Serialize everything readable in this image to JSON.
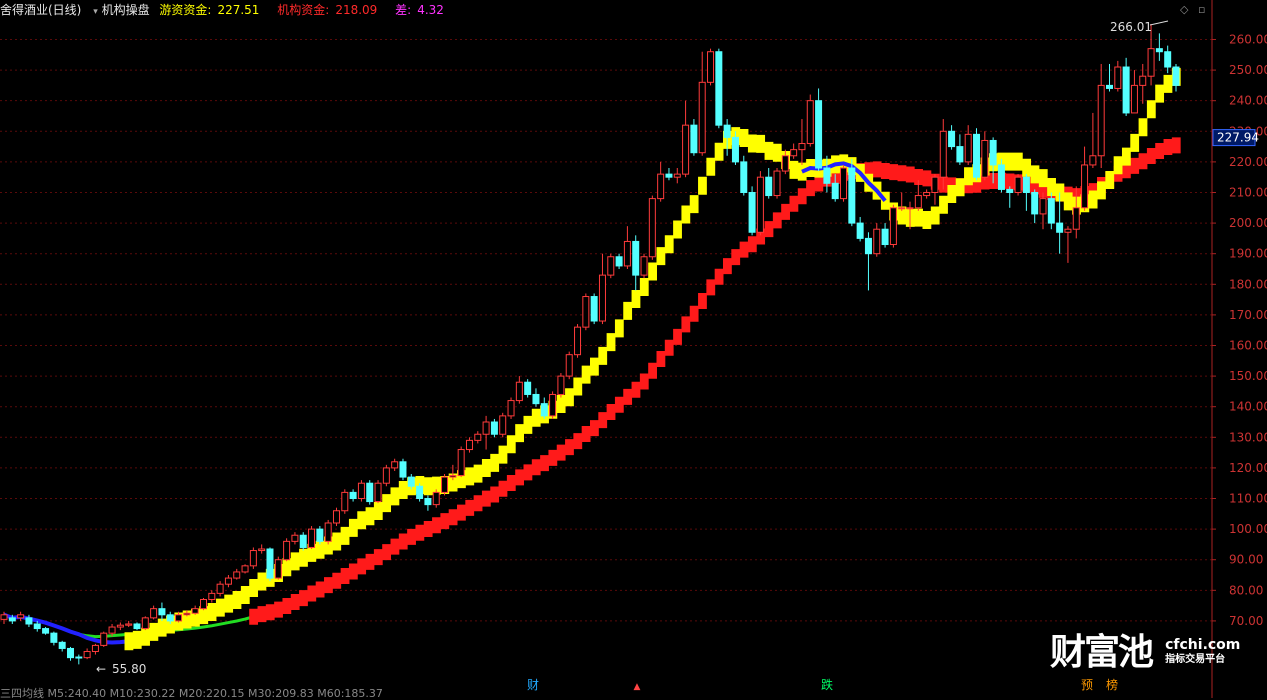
{
  "header": {
    "stock_name": "舍得酒业(日线)",
    "indicator_name": "机构操盘",
    "hot_money_label": "游资资金:",
    "hot_money_value": "227.51",
    "inst_label": "机构资金:",
    "inst_value": "218.09",
    "diff_label": "差:",
    "diff_value": "4.32",
    "colors": {
      "stock": "#e8e8e8",
      "indicator": "#e8e8e8",
      "hot_money": "#ffff00",
      "inst": "#ff2a2a",
      "diff": "#ff33ff"
    }
  },
  "corner_icons": {
    "diamond": "◇",
    "scroll_up": "▫"
  },
  "watermark": {
    "brand": "财富池",
    "url": "cfchi.com",
    "tagline": "指标交易平台"
  },
  "footer": {
    "text": "三四均线 M5:240.40 M10:230.22 M20:220.15 M30:209.83 M60:185.37"
  },
  "markers": [
    {
      "text": "财",
      "color": "#22aaff"
    },
    {
      "text": "▲",
      "color": "#ff4444"
    },
    {
      "text": "跌",
      "color": "#00ff66"
    },
    {
      "text": "预",
      "color": "#ff9900"
    },
    {
      "text": "榜",
      "color": "#ff9900"
    }
  ],
  "chart_data": {
    "type": "candlestick",
    "title": "舍得酒业(日线)",
    "y_axis": {
      "min": 52,
      "max": 268,
      "ticks": [
        70,
        80,
        90,
        100,
        110,
        120,
        130,
        140,
        150,
        160,
        170,
        180,
        190,
        200,
        210,
        220,
        230,
        240,
        250,
        260
      ],
      "side": "right"
    },
    "grid": true,
    "current_price_label": "227.94",
    "annotations": {
      "high": "266.01",
      "low": "55.80"
    },
    "candles": [
      [
        70.5,
        72,
        73,
        69
      ],
      [
        71,
        70,
        72,
        69
      ],
      [
        71,
        72,
        73,
        70
      ],
      [
        71,
        69,
        72,
        68
      ],
      [
        69,
        67.5,
        70,
        66.5
      ],
      [
        67.5,
        66,
        68,
        65.5
      ],
      [
        66,
        63,
        66.5,
        62
      ],
      [
        63,
        61,
        63.5,
        60
      ],
      [
        61,
        58,
        61.5,
        57
      ],
      [
        58.2,
        58,
        59,
        55.8
      ],
      [
        58,
        60,
        61,
        57.5
      ],
      [
        60,
        62,
        62.5,
        59
      ],
      [
        62,
        66,
        66.5,
        61.5
      ],
      [
        66,
        68,
        69,
        65
      ],
      [
        68,
        68.6,
        69.5,
        67
      ],
      [
        68.6,
        69,
        70,
        68
      ],
      [
        69,
        67.5,
        69.5,
        67
      ],
      [
        67.5,
        71,
        71.5,
        67
      ],
      [
        71,
        74,
        75,
        70.5
      ],
      [
        74,
        72,
        76,
        70
      ],
      [
        72,
        70,
        73,
        69
      ],
      [
        70,
        72,
        73,
        69.5
      ],
      [
        72,
        72.5,
        73.5,
        71.5
      ],
      [
        72.5,
        74,
        75,
        72
      ],
      [
        74,
        77,
        77.5,
        73.5
      ],
      [
        77,
        79,
        80,
        76
      ],
      [
        79,
        82,
        83,
        78
      ],
      [
        82,
        84,
        85,
        81
      ],
      [
        84,
        86,
        87,
        83.5
      ],
      [
        86,
        88,
        88.5,
        85.5
      ],
      [
        88,
        93,
        94,
        87
      ],
      [
        93,
        93.5,
        95,
        92
      ],
      [
        93.5,
        84,
        94,
        83
      ],
      [
        84,
        90,
        91,
        83.5
      ],
      [
        90,
        96,
        97,
        89.5
      ],
      [
        96,
        98,
        99,
        95
      ],
      [
        98,
        94,
        99,
        93
      ],
      [
        94,
        100,
        101,
        93.5
      ],
      [
        100,
        96,
        101,
        95
      ],
      [
        96,
        102,
        103,
        95
      ],
      [
        102,
        106,
        107,
        101
      ],
      [
        106,
        112,
        113,
        105
      ],
      [
        112,
        110,
        113,
        109
      ],
      [
        110,
        115,
        116,
        109
      ],
      [
        115,
        109,
        116,
        108
      ],
      [
        109,
        115,
        116,
        108.5
      ],
      [
        115,
        120,
        121,
        114
      ],
      [
        120,
        122,
        123,
        119
      ],
      [
        122,
        117,
        123,
        116
      ],
      [
        117,
        114,
        118,
        113
      ],
      [
        114,
        110,
        115,
        109
      ],
      [
        110,
        108,
        111,
        106
      ],
      [
        108,
        112,
        113,
        107
      ],
      [
        112,
        117,
        118,
        111
      ],
      [
        117,
        117.5,
        121,
        116
      ],
      [
        117.5,
        126,
        127,
        117
      ],
      [
        126,
        129,
        130,
        125
      ],
      [
        129,
        131,
        132,
        128
      ],
      [
        131,
        135,
        137,
        126
      ],
      [
        135,
        131,
        136,
        130
      ],
      [
        131,
        137,
        138,
        130
      ],
      [
        137,
        142,
        143,
        136
      ],
      [
        142,
        148,
        150,
        141
      ],
      [
        148,
        144,
        149,
        143
      ],
      [
        144,
        141,
        146,
        140
      ],
      [
        141,
        137,
        143,
        136
      ],
      [
        137,
        144,
        145,
        136
      ],
      [
        144,
        150,
        151,
        143
      ],
      [
        150,
        157,
        158,
        149
      ],
      [
        157,
        166,
        167,
        156
      ],
      [
        166,
        176,
        177,
        165
      ],
      [
        176,
        168,
        177,
        167
      ],
      [
        168,
        183,
        190,
        167
      ],
      [
        183,
        189,
        190,
        182
      ],
      [
        189,
        186,
        190,
        185
      ],
      [
        186,
        194,
        199,
        185
      ],
      [
        194,
        183,
        196,
        178
      ],
      [
        183,
        189,
        190,
        182
      ],
      [
        189,
        208,
        209,
        188
      ],
      [
        208,
        216,
        220,
        207
      ],
      [
        216,
        215,
        218,
        214
      ],
      [
        215,
        216,
        218,
        213
      ],
      [
        216,
        232,
        240,
        215
      ],
      [
        232,
        223,
        234,
        222
      ],
      [
        223,
        246,
        256,
        222
      ],
      [
        246,
        256,
        257,
        245
      ],
      [
        256,
        232,
        257,
        231
      ],
      [
        232,
        228,
        234,
        222
      ],
      [
        228,
        220,
        230,
        219
      ],
      [
        220,
        210,
        222,
        209
      ],
      [
        210,
        197,
        212,
        196
      ],
      [
        197,
        215,
        217,
        196
      ],
      [
        215,
        209,
        218,
        208
      ],
      [
        209,
        217,
        218,
        208
      ],
      [
        217,
        222,
        224,
        216
      ],
      [
        222,
        224,
        226,
        221
      ],
      [
        224,
        226,
        234,
        219
      ],
      [
        226,
        240,
        242,
        225
      ],
      [
        240,
        218,
        244,
        217
      ],
      [
        218,
        213,
        222,
        210
      ],
      [
        213,
        208,
        216,
        207
      ],
      [
        208,
        218,
        219,
        207
      ],
      [
        218,
        200,
        221,
        199
      ],
      [
        200,
        195,
        202,
        194
      ],
      [
        195,
        190,
        197,
        178
      ],
      [
        190,
        198,
        200,
        189
      ],
      [
        198,
        193,
        200,
        192
      ],
      [
        193,
        205,
        206,
        192
      ],
      [
        205,
        205,
        210,
        204
      ],
      [
        205,
        205,
        207,
        198
      ],
      [
        205,
        209,
        214,
        204
      ],
      [
        209,
        210,
        211,
        208
      ],
      [
        210,
        215,
        216,
        206
      ],
      [
        215,
        230,
        234,
        211
      ],
      [
        230,
        225,
        232,
        224
      ],
      [
        225,
        220,
        229,
        219
      ],
      [
        220,
        229,
        232,
        219
      ],
      [
        229,
        215,
        231,
        214
      ],
      [
        215,
        227,
        230,
        214
      ],
      [
        227,
        219,
        228,
        213
      ],
      [
        219,
        211,
        221,
        210
      ],
      [
        211,
        210,
        212,
        205
      ],
      [
        210,
        215,
        216,
        209
      ],
      [
        215,
        210,
        216,
        204
      ],
      [
        210,
        203,
        211,
        200
      ],
      [
        203,
        208,
        210,
        198
      ],
      [
        208,
        200,
        210,
        198
      ],
      [
        200,
        197,
        210,
        190
      ],
      [
        197,
        198,
        199,
        187
      ],
      [
        198,
        205,
        212,
        195
      ],
      [
        205,
        219,
        225,
        204
      ],
      [
        219,
        222,
        236,
        218
      ],
      [
        222,
        245,
        252,
        218
      ],
      [
        245,
        244,
        252,
        243
      ],
      [
        244,
        251,
        253,
        243
      ],
      [
        251,
        236,
        254,
        235
      ],
      [
        236,
        245,
        250,
        236
      ],
      [
        245,
        248,
        252,
        239
      ],
      [
        248,
        257,
        265,
        245
      ],
      [
        257,
        256,
        262,
        253
      ],
      [
        256,
        251,
        258,
        249
      ],
      [
        251,
        245,
        252,
        243
      ]
    ],
    "series": [
      {
        "name": "游资资金",
        "type": "band",
        "color": "#ffff00",
        "value_last": 227.51
      },
      {
        "name": "机构资金",
        "type": "band",
        "color": "#ff2a2a",
        "value_last": 218.09
      },
      {
        "name": "差",
        "value_last": 4.32
      }
    ]
  }
}
